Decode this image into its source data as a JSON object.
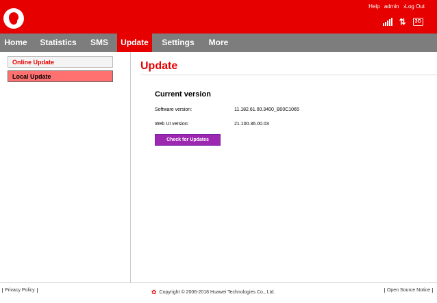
{
  "header": {
    "links": [
      "Help",
      "admin",
      "Log Out"
    ],
    "network_badge": "3G",
    "arrows_glyph": "⇅",
    "brand_color": "#e60000"
  },
  "nav": {
    "items": [
      "Home",
      "Statistics",
      "SMS",
      "Update",
      "Settings",
      "More"
    ],
    "active": "Update"
  },
  "sidebar": {
    "items": [
      "Online Update",
      "Local Update"
    ]
  },
  "main": {
    "title": "Update",
    "section_title": "Current version",
    "rows": [
      {
        "label": "Software version:",
        "value": "11.182.61.00.3400_B00C1065"
      },
      {
        "label": "Web UI version:",
        "value": "21.100.36.00.03"
      }
    ],
    "button_label": "Check for Updates"
  },
  "footer": {
    "privacy": "Privacy Policy",
    "copyright": "Copyright © 2006-2018 Huawei Technologies Co., Ltd.",
    "open_source": "Open Source Notice"
  }
}
